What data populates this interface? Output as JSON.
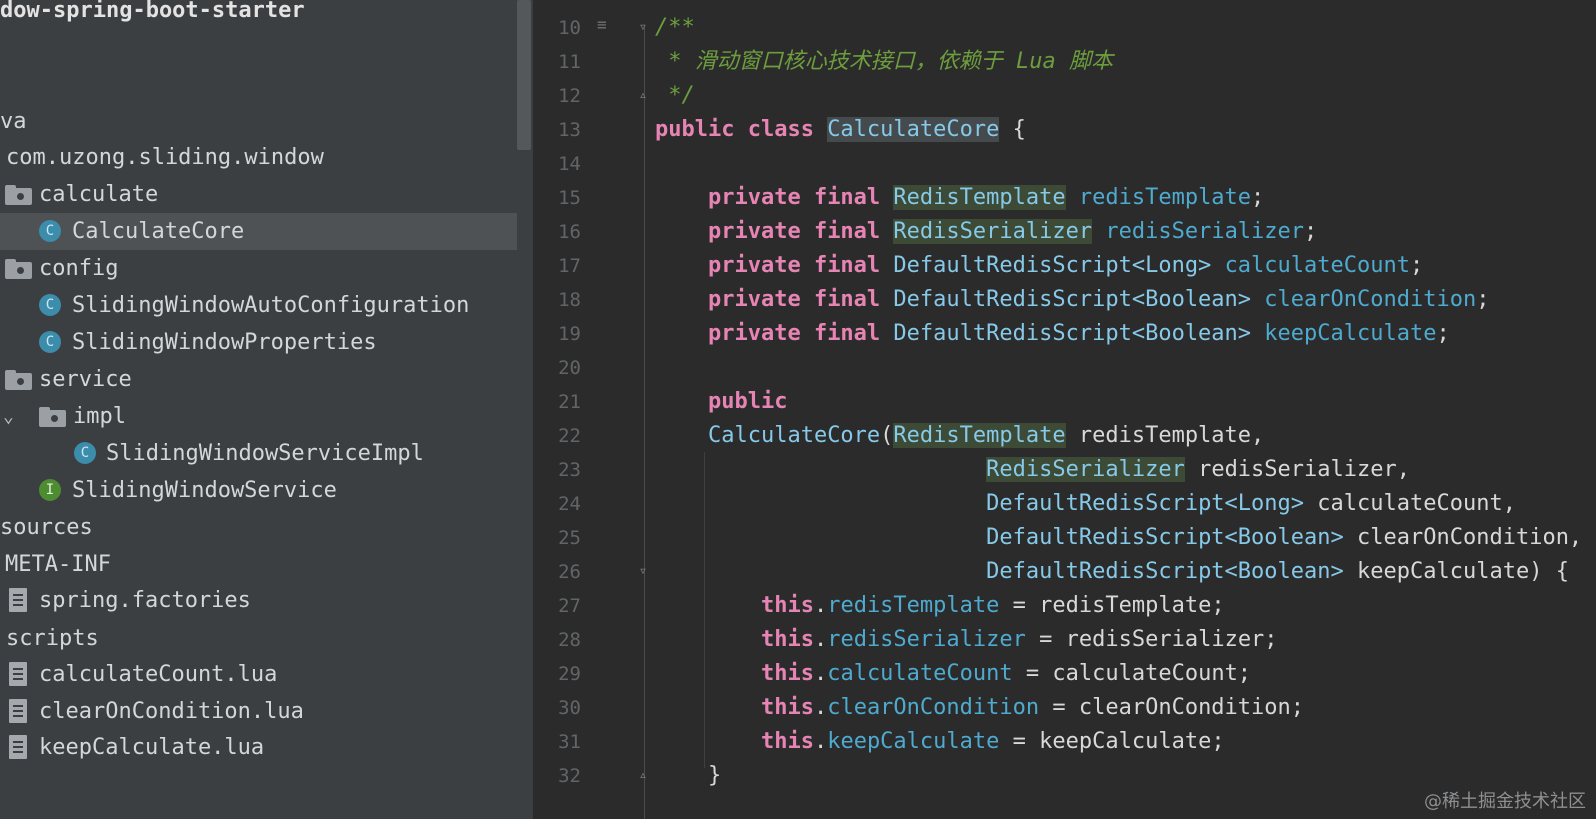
{
  "project_tree": [
    {
      "label": "dow-spring-boot-starter",
      "icon": "none",
      "kind": "root"
    },
    {
      "label": "va",
      "icon": "none",
      "kind": "folder"
    },
    {
      "label": "com.uzong.sliding.window",
      "icon": "none",
      "kind": "package"
    },
    {
      "label": "calculate",
      "icon": "folder-icon",
      "kind": "package"
    },
    {
      "label": "CalculateCore",
      "icon": "class-icon",
      "kind": "class",
      "selected": true
    },
    {
      "label": "config",
      "icon": "folder-icon",
      "kind": "package"
    },
    {
      "label": "SlidingWindowAutoConfiguration",
      "icon": "class-icon",
      "kind": "class"
    },
    {
      "label": "SlidingWindowProperties",
      "icon": "class-icon",
      "kind": "class"
    },
    {
      "label": "service",
      "icon": "folder-icon",
      "kind": "package"
    },
    {
      "label": "impl",
      "icon": "folder-icon",
      "kind": "package",
      "expanded": true
    },
    {
      "label": "SlidingWindowServiceImpl",
      "icon": "class-icon",
      "kind": "class"
    },
    {
      "label": "SlidingWindowService",
      "icon": "interface-icon",
      "kind": "interface"
    },
    {
      "label": "sources",
      "icon": "none",
      "kind": "folder"
    },
    {
      "label": "META-INF",
      "icon": "none",
      "kind": "folder"
    },
    {
      "label": "spring.factories",
      "icon": "file-icon",
      "kind": "file"
    },
    {
      "label": "scripts",
      "icon": "none",
      "kind": "folder"
    },
    {
      "label": "calculateCount.lua",
      "icon": "file-icon",
      "kind": "file"
    },
    {
      "label": "clearOnCondition.lua",
      "icon": "file-icon",
      "kind": "file"
    },
    {
      "label": "keepCalculate.lua",
      "icon": "file-icon",
      "kind": "file"
    }
  ],
  "tree_icon_letters": {
    "class": "C",
    "interface": "I"
  },
  "editor": {
    "line_numbers": [
      "10",
      "11",
      "12",
      "13",
      "14",
      "15",
      "16",
      "17",
      "18",
      "19",
      "20",
      "21",
      "22",
      "23",
      "24",
      "25",
      "26",
      "27",
      "28",
      "29",
      "30",
      "31",
      "32"
    ],
    "code_lines": [
      [
        [
          "cm",
          "/**"
        ]
      ],
      [
        [
          "cm",
          " * 滑动窗口核心技术接口，依赖于 Lua 脚本"
        ]
      ],
      [
        [
          "cm",
          " */"
        ]
      ],
      [
        [
          "kw",
          "public class "
        ],
        [
          "ty hl2",
          "CalculateCore"
        ],
        [
          "p",
          " {"
        ]
      ],
      [],
      [
        [
          "p",
          "    "
        ],
        [
          "kw",
          "private final "
        ],
        [
          "ty hl",
          "RedisTemplate"
        ],
        [
          "p",
          " "
        ],
        [
          "fld",
          "redisTemplate"
        ],
        [
          "p",
          ";"
        ]
      ],
      [
        [
          "p",
          "    "
        ],
        [
          "kw",
          "private final "
        ],
        [
          "ty hl",
          "RedisSerializer"
        ],
        [
          "p",
          " "
        ],
        [
          "fld",
          "redisSerializer"
        ],
        [
          "p",
          ";"
        ]
      ],
      [
        [
          "p",
          "    "
        ],
        [
          "kw",
          "private final "
        ],
        [
          "ty",
          "DefaultRedisScript<Long>"
        ],
        [
          "p",
          " "
        ],
        [
          "fld",
          "calculateCount"
        ],
        [
          "p",
          ";"
        ]
      ],
      [
        [
          "p",
          "    "
        ],
        [
          "kw",
          "private final "
        ],
        [
          "ty",
          "DefaultRedisScript<Boolean>"
        ],
        [
          "p",
          " "
        ],
        [
          "fld",
          "clearOnCondition"
        ],
        [
          "p",
          ";"
        ]
      ],
      [
        [
          "p",
          "    "
        ],
        [
          "kw",
          "private final "
        ],
        [
          "ty",
          "DefaultRedisScript<Boolean>"
        ],
        [
          "p",
          " "
        ],
        [
          "fld",
          "keepCalculate"
        ],
        [
          "p",
          ";"
        ]
      ],
      [],
      [
        [
          "p",
          "    "
        ],
        [
          "kw",
          "public"
        ]
      ],
      [
        [
          "p",
          "    "
        ],
        [
          "ty",
          "CalculateCore"
        ],
        [
          "p",
          "("
        ],
        [
          "ty hl",
          "RedisTemplate"
        ],
        [
          "p",
          " redisTemplate,"
        ]
      ],
      [
        [
          "p",
          "                         "
        ],
        [
          "ty hl",
          "RedisSerializer"
        ],
        [
          "p",
          " redisSerializer,"
        ]
      ],
      [
        [
          "p",
          "                         "
        ],
        [
          "ty",
          "DefaultRedisScript<Long>"
        ],
        [
          "p",
          " calculateCount,"
        ]
      ],
      [
        [
          "p",
          "                         "
        ],
        [
          "ty",
          "DefaultRedisScript<Boolean>"
        ],
        [
          "p",
          " clearOnCondition,"
        ]
      ],
      [
        [
          "p",
          "                         "
        ],
        [
          "ty",
          "DefaultRedisScript<Boolean>"
        ],
        [
          "p",
          " keepCalculate) {"
        ]
      ],
      [
        [
          "p",
          "        "
        ],
        [
          "kw",
          "this"
        ],
        [
          "p",
          "."
        ],
        [
          "fld",
          "redisTemplate"
        ],
        [
          "p",
          " = redisTemplate;"
        ]
      ],
      [
        [
          "p",
          "        "
        ],
        [
          "kw",
          "this"
        ],
        [
          "p",
          "."
        ],
        [
          "fld",
          "redisSerializer"
        ],
        [
          "p",
          " = redisSerializer;"
        ]
      ],
      [
        [
          "p",
          "        "
        ],
        [
          "kw",
          "this"
        ],
        [
          "p",
          "."
        ],
        [
          "fld",
          "calculateCount"
        ],
        [
          "p",
          " = calculateCount;"
        ]
      ],
      [
        [
          "p",
          "        "
        ],
        [
          "kw",
          "this"
        ],
        [
          "p",
          "."
        ],
        [
          "fld",
          "clearOnCondition"
        ],
        [
          "p",
          " = clearOnCondition;"
        ]
      ],
      [
        [
          "p",
          "        "
        ],
        [
          "kw",
          "this"
        ],
        [
          "p",
          "."
        ],
        [
          "fld",
          "keepCalculate"
        ],
        [
          "p",
          " = keepCalculate;"
        ]
      ],
      [
        [
          "p",
          "    }"
        ]
      ]
    ]
  },
  "watermark": "@稀土掘金技术社区"
}
